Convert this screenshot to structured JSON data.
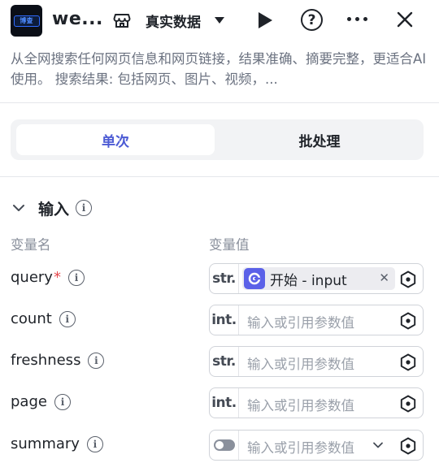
{
  "header": {
    "title": "we...",
    "logo_text": "博查",
    "data_label": "真实数据"
  },
  "description": "从全网搜索任何网页信息和网页链接，结果准确、摘要完整，更适合AI使用。 搜索结果: 包括网页、图片、视频，...",
  "tabs": {
    "single": "单次",
    "batch": "批处理"
  },
  "input_section": {
    "title": "输入",
    "col_name": "变量名",
    "col_value": "变量值"
  },
  "params": [
    {
      "name": "query",
      "required": "*",
      "type": "str.",
      "ref": "开始 - input"
    },
    {
      "name": "count",
      "type": "int.",
      "placeholder": "输入或引用参数值"
    },
    {
      "name": "freshness",
      "type": "str.",
      "placeholder": "输入或引用参数值"
    },
    {
      "name": "page",
      "type": "int.",
      "placeholder": "输入或引用参数值"
    },
    {
      "name": "summary",
      "type": "bool",
      "placeholder": "输入或引用参数值"
    }
  ],
  "colors": {
    "accent": "#4c5bd4",
    "chip_icon": "#5b61e8",
    "required": "#e5484d"
  }
}
